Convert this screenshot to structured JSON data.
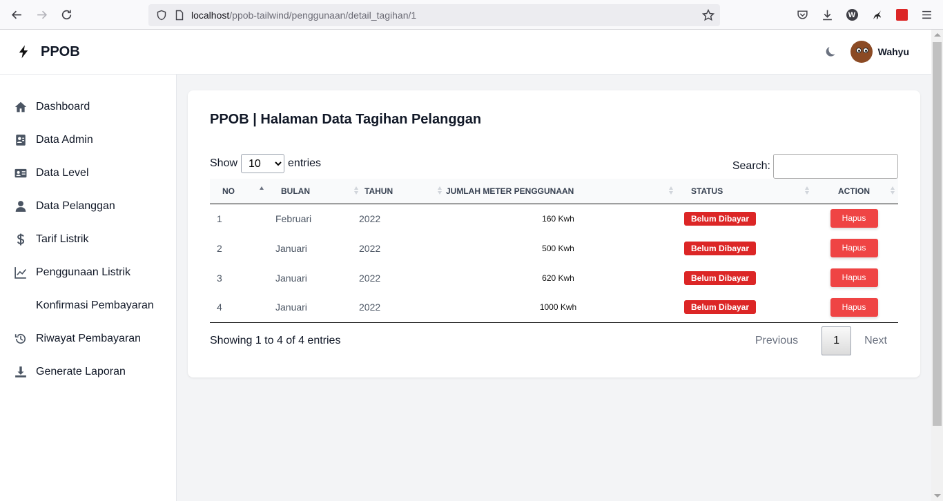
{
  "browser": {
    "url_host": "localhost",
    "url_path": "/ppob-tailwind/penggunaan/detail_tagihan/1"
  },
  "header": {
    "brand": "PPOB",
    "user_name": "Wahyu"
  },
  "sidebar": {
    "items": [
      {
        "label": "Dashboard",
        "icon": "home-icon"
      },
      {
        "label": "Data Admin",
        "icon": "id-card-icon"
      },
      {
        "label": "Data Level",
        "icon": "address-card-icon"
      },
      {
        "label": "Data Pelanggan",
        "icon": "user-icon"
      },
      {
        "label": "Tarif Listrik",
        "icon": "dollar-icon"
      },
      {
        "label": "Penggunaan Listrik",
        "icon": "chart-line-icon"
      },
      {
        "label": "Konfirmasi Pembayaran",
        "icon": ""
      },
      {
        "label": "Riwayat Pembayaran",
        "icon": "history-icon"
      },
      {
        "label": "Generate Laporan",
        "icon": "download-icon"
      }
    ]
  },
  "main": {
    "title": "PPOB | Halaman Data Tagihan Pelanggan",
    "show_label": "Show",
    "entries_label": "entries",
    "page_length": "10",
    "search_label": "Search:",
    "search_value": "",
    "columns": [
      "NO",
      "BULAN",
      "TAHUN",
      "JUMLAH METER PENGGUNAAN",
      "STATUS",
      "ACTION"
    ],
    "rows": [
      {
        "no": "1",
        "bulan": "Februari",
        "tahun": "2022",
        "meter": "160 Kwh",
        "status": "Belum Dibayar",
        "action": "Hapus"
      },
      {
        "no": "2",
        "bulan": "Januari",
        "tahun": "2022",
        "meter": "500 Kwh",
        "status": "Belum Dibayar",
        "action": "Hapus"
      },
      {
        "no": "3",
        "bulan": "Januari",
        "tahun": "2022",
        "meter": "620 Kwh",
        "status": "Belum Dibayar",
        "action": "Hapus"
      },
      {
        "no": "4",
        "bulan": "Januari",
        "tahun": "2022",
        "meter": "1000 Kwh",
        "status": "Belum Dibayar",
        "action": "Hapus"
      }
    ],
    "info": "Showing 1 to 4 of 4 entries",
    "pagination": {
      "previous": "Previous",
      "current": "1",
      "next": "Next"
    }
  },
  "colors": {
    "status_badge": "#dc2626",
    "delete_button": "#ef4444"
  }
}
